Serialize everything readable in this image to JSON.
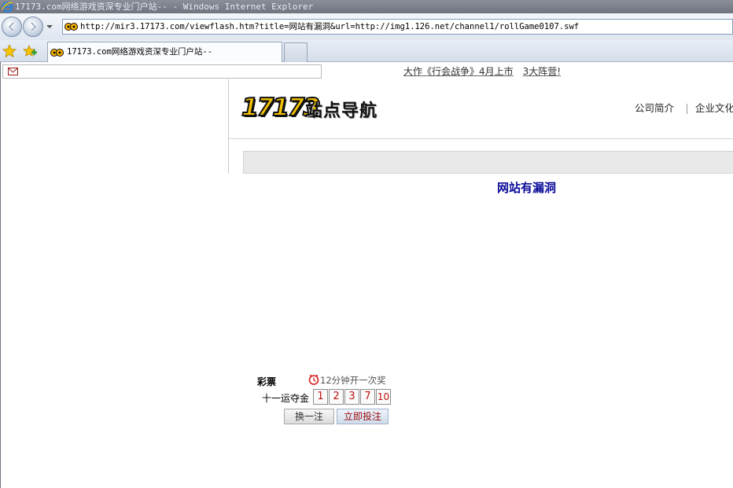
{
  "window": {
    "title": "17173.com网络游戏资深专业门户站-- - Windows Internet Explorer"
  },
  "address_bar": {
    "url": "http://mir3.17173.com/viewflash.htm?title=网站有漏洞&url=http://img1.126.net/channel1/rollGame0107.swf"
  },
  "tabs": [
    {
      "label": "17173.com网络游戏资深专业门户站--"
    }
  ],
  "ticker": {
    "items": [
      "大作《行会战争》4月上市",
      "3大阵营!"
    ]
  },
  "header": {
    "logo_number": "17173",
    "logo_text": "站点导航",
    "links": [
      "公司简介",
      "企业文化"
    ]
  },
  "flash": {
    "title": "网站有漏洞"
  },
  "lottery": {
    "label": "彩票",
    "countdown": "12分钟开一次奖",
    "game_name": "十一运夺金",
    "numbers": [
      "1",
      "2",
      "3",
      "7",
      "10"
    ],
    "swap_label": "换一注",
    "bet_label": "立即投注"
  },
  "colors": {
    "flash_title": "#0a0a9a",
    "lottery_number": "#c01010",
    "logo_yellow": "#f3c200"
  }
}
